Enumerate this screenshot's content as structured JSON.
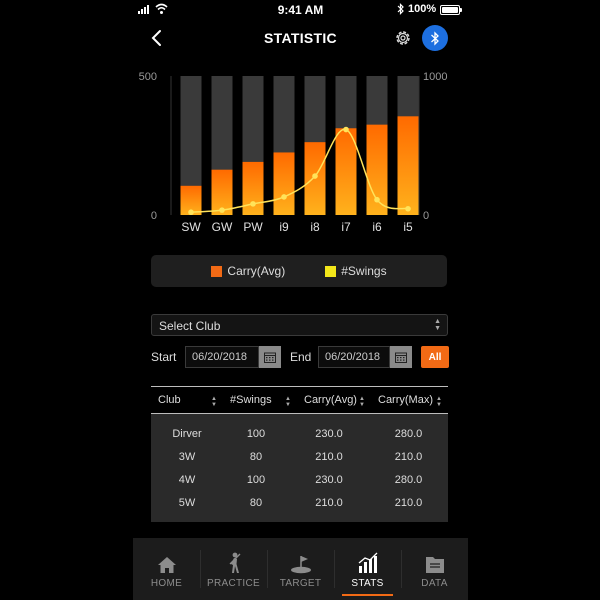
{
  "status_bar": {
    "time": "9:41 AM",
    "battery": "100%"
  },
  "header": {
    "title": "STATISTIC"
  },
  "chart_data": {
    "type": "bar",
    "categories": [
      "SW",
      "GW",
      "PW",
      "i9",
      "i8",
      "i7",
      "i6",
      "i5"
    ],
    "series": [
      {
        "name": "Carry(Avg)",
        "type": "bar",
        "axis": "left",
        "values": [
          105,
          163,
          191,
          225,
          262,
          312,
          325,
          355
        ]
      },
      {
        "name": "#Swings",
        "type": "line",
        "axis": "right",
        "values": [
          20,
          35,
          80,
          130,
          280,
          615,
          110,
          45
        ]
      }
    ],
    "y_left": {
      "ylim": [
        0,
        500
      ],
      "ticks": [
        "0",
        "500"
      ]
    },
    "y_right": {
      "ylim": [
        0,
        1000
      ],
      "ticks": [
        "0",
        "1000"
      ]
    },
    "colors": {
      "bar_top": "#ff6a00",
      "bar_bottom": "#ffb21c",
      "bar_bg": "#3a3a3a",
      "line": "#ffe35a"
    },
    "legend": "bottom"
  },
  "legend": {
    "carry_label": "Carry(Avg)",
    "swings_label": "#Swings",
    "carry_color": "#f26a15",
    "swings_color": "#f2e61a"
  },
  "filter": {
    "select_club": "Select Club",
    "start_label": "Start",
    "start_date": "06/20/2018",
    "end_label": "End",
    "end_date": "06/20/2018",
    "all_button": "All"
  },
  "table": {
    "columns": [
      "Club",
      "#Swings",
      "Carry(Avg)",
      "Carry(Max)"
    ],
    "rows": [
      [
        "Dirver",
        "100",
        "230.0",
        "280.0"
      ],
      [
        "3W",
        "80",
        "210.0",
        "210.0"
      ],
      [
        "4W",
        "100",
        "230.0",
        "280.0"
      ],
      [
        "5W",
        "80",
        "210.0",
        "210.0"
      ]
    ]
  },
  "tabs": [
    {
      "label": "HOME",
      "icon": "home-icon",
      "active": false
    },
    {
      "label": "PRACTICE",
      "icon": "golfer-icon",
      "active": false
    },
    {
      "label": "TARGET",
      "icon": "flag-icon",
      "active": false
    },
    {
      "label": "STATS",
      "icon": "bar-chart-icon",
      "active": true
    },
    {
      "label": "DATA",
      "icon": "folder-icon",
      "active": false
    }
  ]
}
